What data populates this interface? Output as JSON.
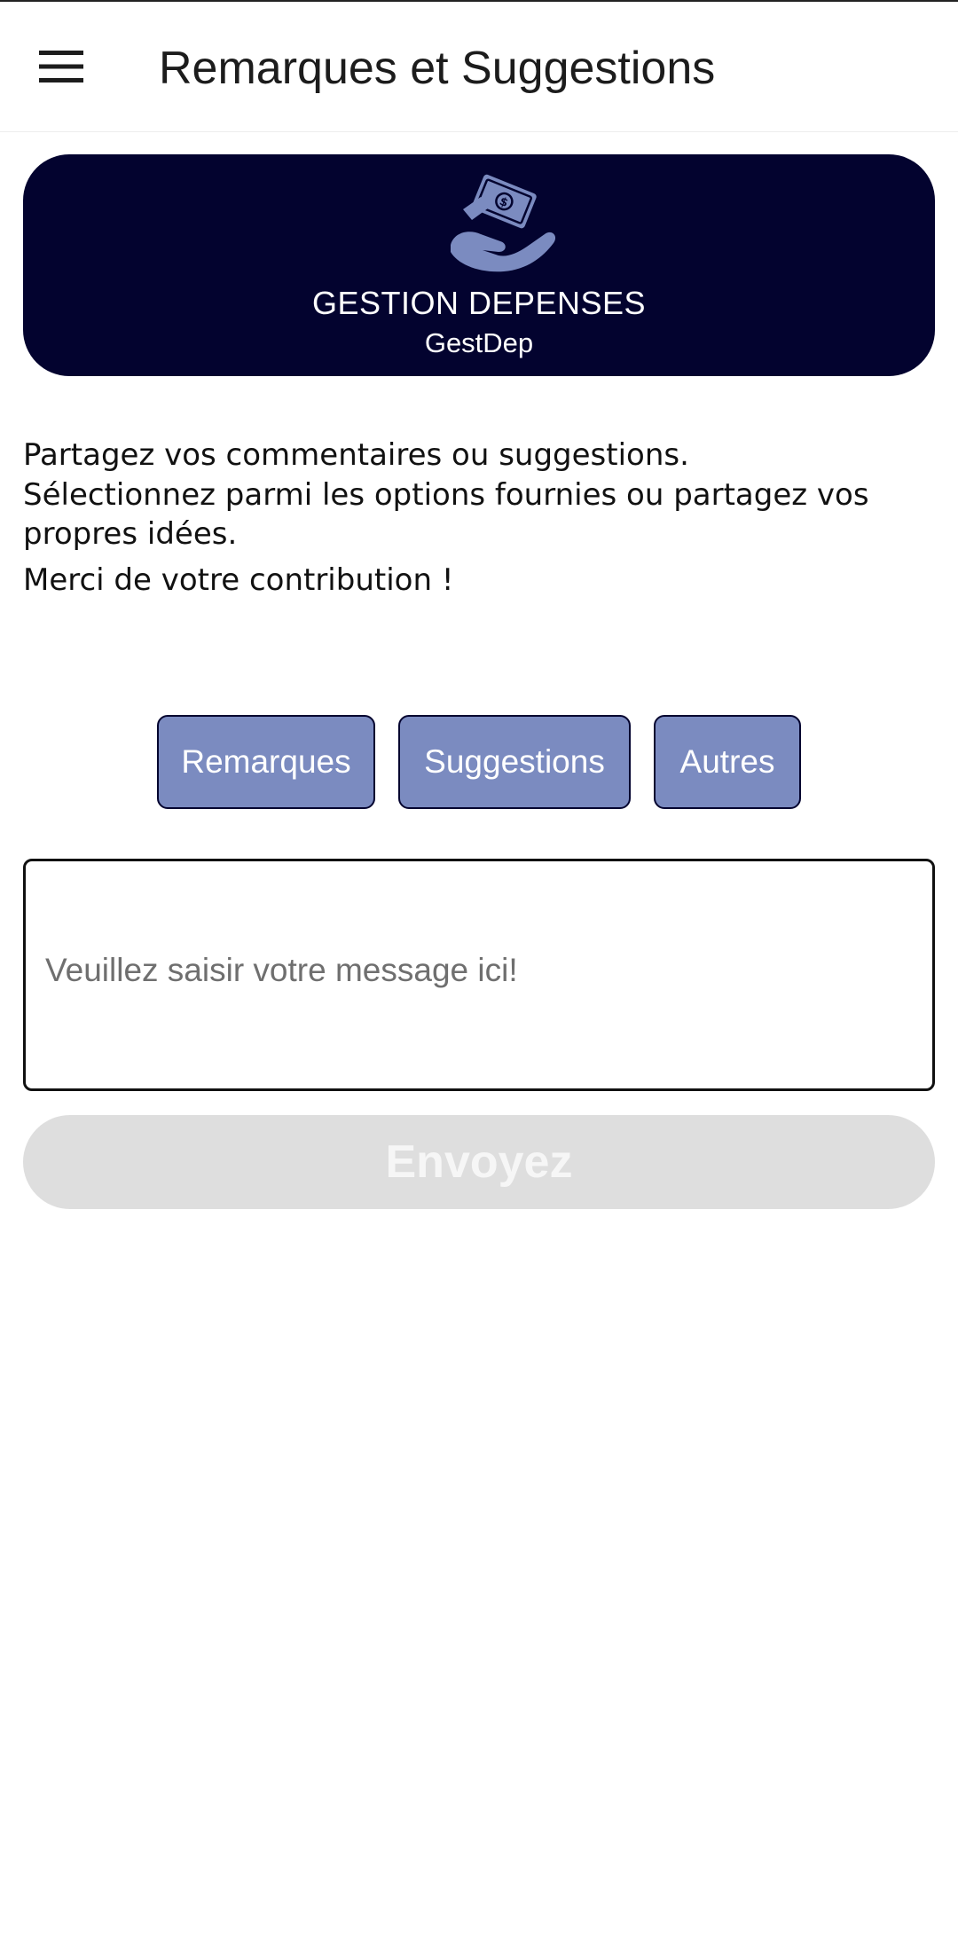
{
  "appbar": {
    "title": "Remarques et Suggestions",
    "menu_icon": "hamburger-menu-icon"
  },
  "banner": {
    "logo_icon": "hand-holding-money-icon",
    "title": "GESTION DEPENSES",
    "subtitle": "GestDep",
    "background_color": "#03032f"
  },
  "intro": {
    "line1": "Partagez vos commentaires ou suggestions.",
    "line2": "Sélectionnez parmi les options fournies ou partagez vos propres idées.",
    "line3": "Merci de votre contribution !"
  },
  "categories": [
    {
      "label": "Remarques"
    },
    {
      "label": "Suggestions"
    },
    {
      "label": "Autres"
    }
  ],
  "message": {
    "value": "",
    "placeholder": "Veuillez saisir votre message ici!"
  },
  "send_button": {
    "label": "Envoyez",
    "state": "disabled"
  },
  "colors": {
    "chip": "#7b8bc0",
    "logo": "#7b8bc0",
    "disabled_button": "#dedede"
  }
}
